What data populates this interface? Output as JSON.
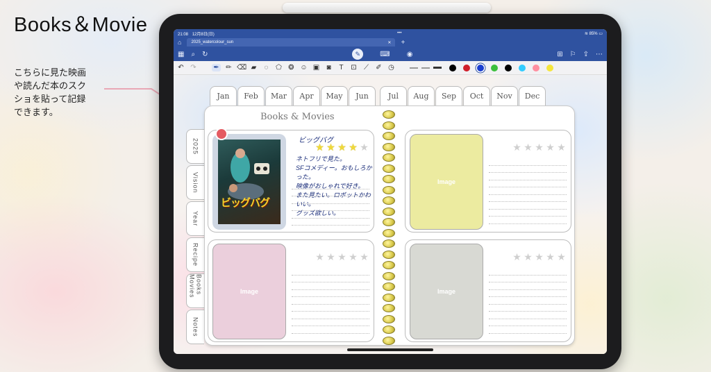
{
  "promo": {
    "title": "Books＆Movie",
    "caption": "こちらに見た映画\nや読んだ本のスク\nショを貼って記録\nできます。"
  },
  "status_bar": {
    "time": "21:08",
    "date": "12月8日(日)",
    "battery": "85%"
  },
  "document_tab": {
    "name": "2025_watercolour_sun"
  },
  "toolbar": {
    "colors": [
      "#000000",
      "#d01f2a",
      "#1a3fd0",
      "#3cc03c",
      "#000000",
      "#33ccff",
      "#ff8fa0",
      "#f5e63c"
    ],
    "selected_color_index": 2
  },
  "notebook": {
    "months_left": [
      "Jan",
      "Feb",
      "Mar",
      "Apr",
      "May",
      "Jun"
    ],
    "months_right": [
      "Jul",
      "Aug",
      "Sep",
      "Oct",
      "Nov",
      "Dec"
    ],
    "side_tabs": [
      "2025",
      "Vision",
      "Year",
      "Recipe",
      "Books Movies",
      "Notes"
    ],
    "page_title": "Books & Movies",
    "cards": [
      {
        "kind": "poster",
        "poster_title": "ビッグバグ",
        "rating": 4,
        "max_rating": 5,
        "handwritten_title": "ビッグバグ",
        "handwritten_note": "ネトフリで見た。\nSFコメディー。おもしろかった。\n映像がおしゃれで好き。\nまた見たい。ロボットかわいい。\nグッズ欲しい。"
      },
      {
        "kind": "image",
        "placeholder": "Image",
        "bg": "#eceba0",
        "rating": 0,
        "max_rating": 5
      },
      {
        "kind": "image",
        "placeholder": "Image",
        "bg": "#ebcfdc",
        "rating": 0,
        "max_rating": 5
      },
      {
        "kind": "image",
        "placeholder": "Image",
        "bg": "#d8d9d3",
        "rating": 0,
        "max_rating": 5
      }
    ]
  }
}
